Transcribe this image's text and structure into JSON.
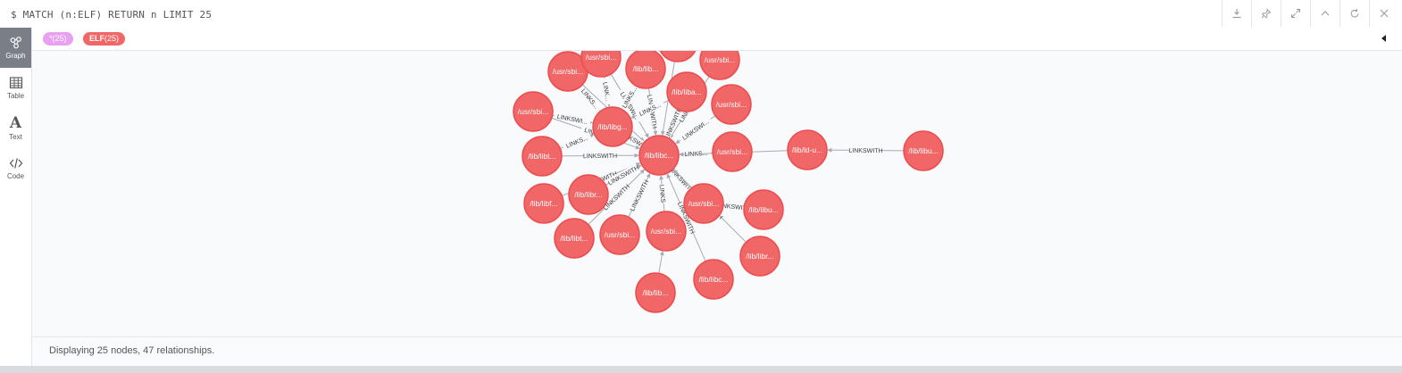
{
  "header": {
    "query": "$ MATCH (n:ELF) RETURN n LIMIT 25",
    "toolbar": [
      {
        "icon": "download-icon"
      },
      {
        "icon": "pin-icon"
      },
      {
        "icon": "expand-icon"
      },
      {
        "icon": "collapse-up-icon"
      },
      {
        "icon": "rerun-icon"
      },
      {
        "icon": "close-icon"
      }
    ]
  },
  "nav": {
    "graph": "Graph",
    "table": "Table",
    "text": "Text",
    "code": "Code"
  },
  "legend": {
    "all_label": "*(25)",
    "elf_label": "ELF",
    "elf_count": "(25)"
  },
  "colors": {
    "node_fill": "#f16667",
    "node_stroke": "#eb4d4f",
    "all_pill": "#e8a0f0",
    "active_nav": "#7a7f87"
  },
  "graph": {
    "relationship_type": "LINKSWITH",
    "nodes": [
      {
        "id": "n1",
        "label": "/usr/sbi..."
      },
      {
        "id": "n2",
        "label": "/usr/sbi..."
      },
      {
        "id": "n3",
        "label": "/lib/lib..."
      },
      {
        "id": "n4",
        "label": ""
      },
      {
        "id": "n5",
        "label": "/usr/sbi..."
      },
      {
        "id": "n6",
        "label": "/lib/liba..."
      },
      {
        "id": "n7",
        "label": "/usr/sbi..."
      },
      {
        "id": "n8",
        "label": "/usr/sbi..."
      },
      {
        "id": "n9",
        "label": "/lib/libg..."
      },
      {
        "id": "n10",
        "label": "/usr/sbi..."
      },
      {
        "id": "n11",
        "label": "/lib/libt..."
      },
      {
        "id": "n12",
        "label": "/lib/libc..."
      },
      {
        "id": "n13",
        "label": "/lib/ld-u..."
      },
      {
        "id": "n14",
        "label": "/lib/libu..."
      },
      {
        "id": "n15",
        "label": "/lib/libf..."
      },
      {
        "id": "n16",
        "label": "/lib/libr..."
      },
      {
        "id": "n17",
        "label": "/usr/sbi..."
      },
      {
        "id": "n18",
        "label": "/lib/libu..."
      },
      {
        "id": "n19",
        "label": "/lib/libt..."
      },
      {
        "id": "n20",
        "label": "/usr/sbi..."
      },
      {
        "id": "n21",
        "label": "/usr/sbi..."
      },
      {
        "id": "n22",
        "label": "/lib/libr..."
      },
      {
        "id": "n23",
        "label": "/lib/libc..."
      },
      {
        "id": "n24",
        "label": "/lib/lib..."
      }
    ],
    "relationships": [
      {
        "from": "n1",
        "to": "n9",
        "label": "LINKS..."
      },
      {
        "from": "n1",
        "to": "n12",
        "label": ""
      },
      {
        "from": "n2",
        "to": "n9",
        "label": "LINK..."
      },
      {
        "from": "n2",
        "to": "n12",
        "label": "LINKSWI..."
      },
      {
        "from": "n3",
        "to": "n9",
        "label": "LINKS..."
      },
      {
        "from": "n3",
        "to": "n12",
        "label": "LINKSWITH"
      },
      {
        "from": "n4",
        "to": "n12",
        "label": ""
      },
      {
        "from": "n5",
        "to": "n12",
        "label": "LINKSWITH"
      },
      {
        "from": "n6",
        "to": "n12",
        "label": "LINKSWITH"
      },
      {
        "from": "n6",
        "to": "n9",
        "label": "LINKS..."
      },
      {
        "from": "n7",
        "to": "n12",
        "label": "LINKSWI..."
      },
      {
        "from": "n8",
        "to": "n9",
        "label": "LINKSWI..."
      },
      {
        "from": "n8",
        "to": "n12",
        "label": "LINKS..."
      },
      {
        "from": "n9",
        "to": "n12",
        "label": "LINKSWITH"
      },
      {
        "from": "n10",
        "to": "n12",
        "label": "LINKS..."
      },
      {
        "from": "n11",
        "to": "n9",
        "label": "LINKS..."
      },
      {
        "from": "n11",
        "to": "n12",
        "label": "LINKSWITH"
      },
      {
        "from": "n13",
        "to": "n12",
        "label": ""
      },
      {
        "from": "n14",
        "to": "n13",
        "label": "LINKSWITH"
      },
      {
        "from": "n15",
        "to": "n12",
        "label": "LINKSWITH"
      },
      {
        "from": "n16",
        "to": "n12",
        "label": "LINKSWITH"
      },
      {
        "from": "n17",
        "to": "n12",
        "label": "LINKSWITH"
      },
      {
        "from": "n18",
        "to": "n17",
        "label": "LINKSWITH"
      },
      {
        "from": "n19",
        "to": "n12",
        "label": "LINKSWITH"
      },
      {
        "from": "n20",
        "to": "n12",
        "label": "LINKSWITH"
      },
      {
        "from": "n21",
        "to": "n12",
        "label": "LINKS"
      },
      {
        "from": "n22",
        "to": "n12",
        "label": "LINKSWITH"
      },
      {
        "from": "n23",
        "to": "n12",
        "label": "LINKSWITH"
      },
      {
        "from": "n24",
        "to": "n21",
        "label": ""
      }
    ]
  },
  "status": {
    "text": "Displaying 25 nodes, 47 relationships."
  }
}
